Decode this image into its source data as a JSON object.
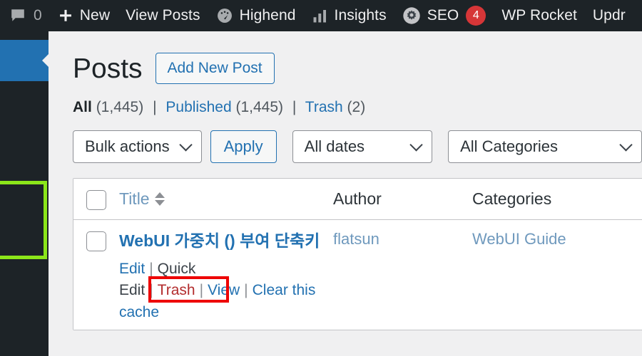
{
  "colors": {
    "admin_bar_bg": "#1d2327",
    "sidebar_bg": "#1d2327",
    "current_menu_blue": "#2271b1",
    "page_bg": "#f0f0f1",
    "link_blue": "#2271b1",
    "trash_red": "#b32d2e",
    "badge_red": "#d63638",
    "annotation_green": "#8ce61a",
    "annotation_red": "#ee0000"
  },
  "admin_bar": {
    "comments": {
      "icon": "comment-bubble-icon",
      "count": "0"
    },
    "items": [
      {
        "icon": "plus-icon",
        "label": "New"
      },
      {
        "icon": "",
        "label": "View Posts"
      },
      {
        "icon": "dashboard-gauge-icon",
        "label": "Highend"
      },
      {
        "icon": "bar-chart-icon",
        "label": "Insights"
      },
      {
        "icon": "seo-gear-icon",
        "label": "SEO",
        "badge": "4"
      },
      {
        "icon": "",
        "label": "WP Rocket"
      },
      {
        "icon": "",
        "label": "Updr"
      }
    ]
  },
  "sidebar": {
    "items": [
      {
        "name": "menu-item-above",
        "current": false
      },
      {
        "name": "menu-item-posts",
        "current": true
      },
      {
        "name": "menu-item-below",
        "current": false
      }
    ]
  },
  "page": {
    "title": "Posts",
    "add_new_label": "Add New Post"
  },
  "views": {
    "items": [
      {
        "label": "All",
        "count": "(1,445)",
        "current": true
      },
      {
        "label": "Published",
        "count": "(1,445)",
        "current": false
      },
      {
        "label": "Trash",
        "count": "(2)",
        "current": false
      }
    ],
    "separator": "|"
  },
  "tablenav": {
    "bulk_actions_value": "Bulk actions",
    "apply_label": "Apply",
    "dates_value": "All dates",
    "categories_value": "All Categories"
  },
  "table": {
    "columns": {
      "title": "Title",
      "author": "Author",
      "categories": "Categories"
    },
    "rows": [
      {
        "title": "WebUI 가중치 () 부여 단축키",
        "author": "flatsun",
        "categories": "WebUI Guide",
        "actions": [
          {
            "label": "Edit",
            "kind": "link"
          },
          {
            "label": "Quick Edit",
            "kind": "boxed"
          },
          {
            "label": "Trash",
            "kind": "trash"
          },
          {
            "label": "View",
            "kind": "link"
          },
          {
            "label": "Clear this cache",
            "kind": "link"
          }
        ],
        "action_separator": "|"
      }
    ]
  }
}
